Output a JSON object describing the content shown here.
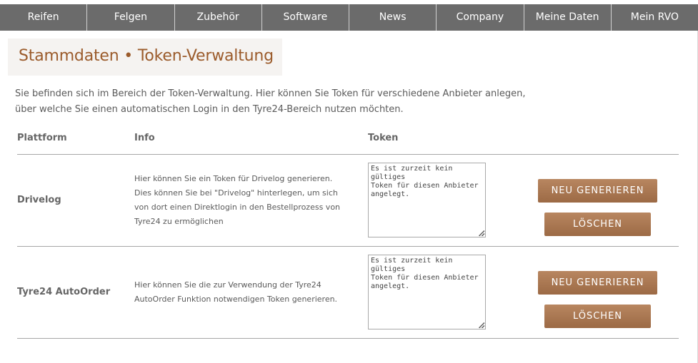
{
  "nav": {
    "items": [
      {
        "label": "Reifen"
      },
      {
        "label": "Felgen"
      },
      {
        "label": "Zubehör"
      },
      {
        "label": "Software"
      },
      {
        "label": "News"
      },
      {
        "label": "Company"
      },
      {
        "label": "Meine Daten"
      },
      {
        "label": "Mein RVO"
      }
    ]
  },
  "page": {
    "title": "Stammdaten • Token-Verwaltung",
    "intro_line1": "Sie befinden sich im Bereich der Token-Verwaltung. Hier können Sie Token für verschiedene Anbieter anlegen,",
    "intro_line2": "über welche Sie einen automatischen Login in den Tyre24-Bereich nutzen möchten."
  },
  "table": {
    "headers": {
      "platform": "Plattform",
      "info": "Info",
      "token": "Token"
    },
    "rows": [
      {
        "platform": "Drivelog",
        "info_lines": [
          "Hier können Sie ein Token für Drivelog generieren.",
          "Dies können Sie bei \"Drivelog\" hinterlegen, um sich",
          "von dort einen Direktlogin in den Bestellprozess von",
          "Tyre24 zu ermöglichen"
        ],
        "token_lines": [
          "Es ist zurzeit kein gültiges",
          "Token für diesen Anbieter",
          "angelegt."
        ],
        "generate_label": "NEU GENERIEREN",
        "delete_label": "LÖSCHEN"
      },
      {
        "platform": "Tyre24 AutoOrder",
        "info_lines": [
          "Hier können Sie die zur Verwendung der Tyre24",
          "AutoOrder Funktion notwendigen Token generieren."
        ],
        "token_lines": [
          "Es ist zurzeit kein gültiges",
          "Token für diesen Anbieter",
          "angelegt."
        ],
        "generate_label": "NEU GENERIEREN",
        "delete_label": "LÖSCHEN"
      }
    ]
  }
}
